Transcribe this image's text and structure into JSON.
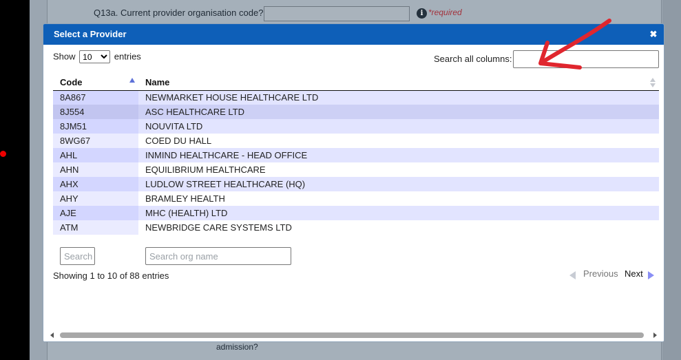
{
  "background_form": {
    "q13a_label": "Q13a. Current provider organisation code?",
    "q13a_required": "*required",
    "admission_text": "admission?"
  },
  "dialog": {
    "title": "Select a Provider",
    "close_icon": "close-icon",
    "length": {
      "show_label": "Show",
      "selected": "10",
      "options": [
        "10"
      ],
      "entries_label": "entries"
    },
    "search_all_label": "Search all columns:",
    "search_all_value": "",
    "columns": [
      "Code",
      "Name"
    ],
    "rows": [
      {
        "code": "8A867",
        "name": "NEWMARKET HOUSE HEALTHCARE LTD"
      },
      {
        "code": "8J554",
        "name": "ASC HEALTHCARE LTD"
      },
      {
        "code": "8JM51",
        "name": "NOUVITA LTD"
      },
      {
        "code": "8WG67",
        "name": "COED DU HALL"
      },
      {
        "code": "AHL",
        "name": "INMIND HEALTHCARE - HEAD OFFICE"
      },
      {
        "code": "AHN",
        "name": "EQUILIBRIUM HEALTHCARE"
      },
      {
        "code": "AHX",
        "name": "LUDLOW STREET HEALTHCARE (HQ)"
      },
      {
        "code": "AHY",
        "name": "BRAMLEY HEALTH"
      },
      {
        "code": "AJE",
        "name": "MHC (HEALTH) LTD"
      },
      {
        "code": "ATM",
        "name": "NEWBRIDGE CARE SYSTEMS LTD"
      }
    ],
    "footer_search_code_placeholder": "Search",
    "footer_search_name_placeholder": "Search org name",
    "info_text": "Showing 1 to 10 of 88 entries",
    "pager": {
      "previous": "Previous",
      "next": "Next"
    }
  },
  "colors": {
    "title_bar": "#0e5fb8",
    "odd_row": "#e2e4ff",
    "hover_row": "#cdd0f5",
    "annotation_arrow": "#e0262e"
  }
}
